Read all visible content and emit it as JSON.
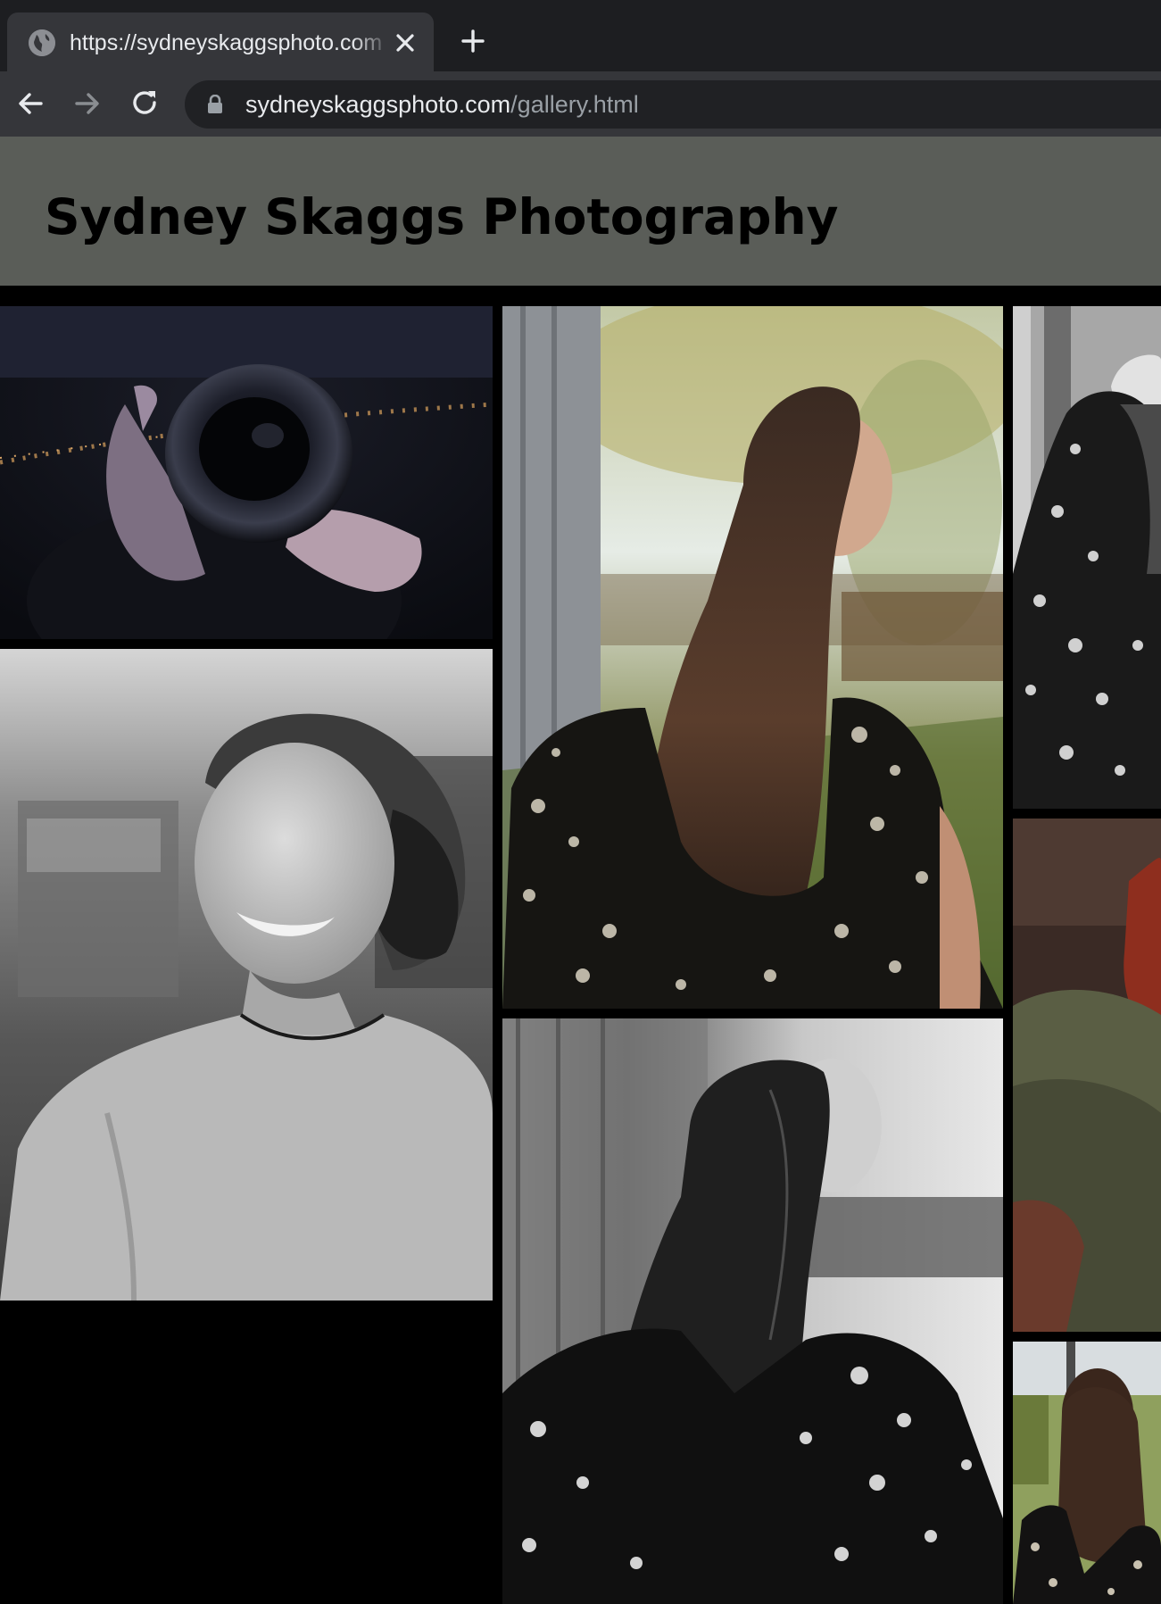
{
  "browser": {
    "tab": {
      "title": "https://sydneyskaggsphoto.com",
      "favicon": "globe-icon",
      "close_icon": "close-icon"
    },
    "new_tab_icon": "plus-icon",
    "nav": {
      "back_icon": "arrow-left-icon",
      "forward_icon": "arrow-right-icon",
      "reload_icon": "reload-icon"
    },
    "address_bar": {
      "lock_icon": "lock-icon",
      "host": "sydneyskaggsphoto.com",
      "path": "/gallery.html"
    }
  },
  "site": {
    "title": "Sydney Skaggs Photography",
    "header_bg": "#5a5d58"
  },
  "gallery": {
    "photos": [
      {
        "id": "photo-camera-lens",
        "subject": "hands holding camera lens, dark background"
      },
      {
        "id": "photo-bw-smiling-woman",
        "subject": "black and white portrait of smiling woman"
      },
      {
        "id": "photo-long-hair-floral-dress",
        "subject": "woman with long brown hair, floral dress, outdoors"
      },
      {
        "id": "photo-bw-long-hair",
        "subject": "black and white woman with long hair, floral dress"
      },
      {
        "id": "photo-floral-dress-arm-raised",
        "subject": "floral dress, arm raised, black and white"
      },
      {
        "id": "photo-green-sweater",
        "subject": "person in green sweater, red hair"
      },
      {
        "id": "photo-long-hair-back",
        "subject": "woman with long hair from behind, floral dress"
      }
    ]
  }
}
